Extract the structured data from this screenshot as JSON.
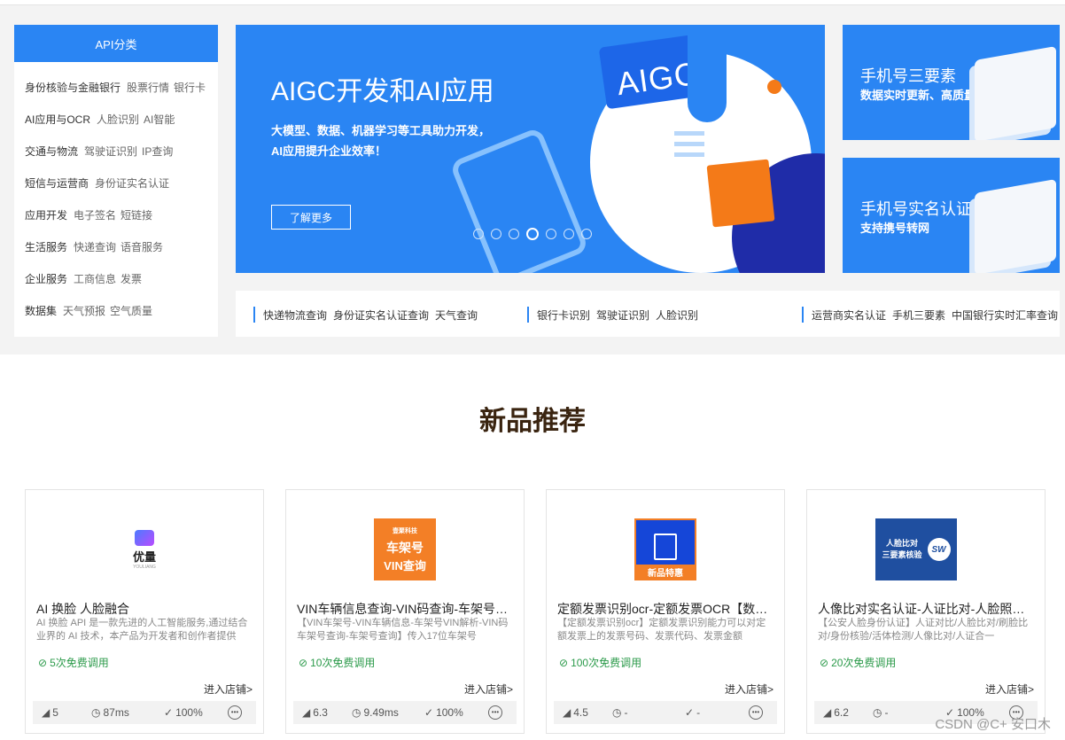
{
  "category_menu": {
    "header": "API分类",
    "rows": [
      {
        "main": "身份核验与金融银行",
        "subs": [
          "股票行情",
          "银行卡"
        ]
      },
      {
        "main": "AI应用与OCR",
        "subs": [
          "人脸识别",
          "AI智能"
        ]
      },
      {
        "main": "交通与物流",
        "subs": [
          "驾驶证识别",
          "IP查询"
        ]
      },
      {
        "main": "短信与运营商",
        "subs": [
          "身份证实名认证"
        ]
      },
      {
        "main": "应用开发",
        "subs": [
          "电子签名",
          "短链接"
        ]
      },
      {
        "main": "生活服务",
        "subs": [
          "快递查询",
          "语音服务"
        ]
      },
      {
        "main": "企业服务",
        "subs": [
          "工商信息",
          "发票"
        ]
      },
      {
        "main": "数据集",
        "subs": [
          "天气预报",
          "空气质量"
        ]
      }
    ]
  },
  "banner": {
    "title": "AIGC开发和AI应用",
    "description": "大模型、数据、机器学习等工具助力开发，AI应用提升企业效率！",
    "button_label": "了解更多",
    "art_text": "AIGC",
    "dot_count": 7,
    "active_dot": 3,
    "colors": {
      "background": "#2a85f3",
      "accent_orange": "#f47a18",
      "deep_blue": "#1f2ca8"
    }
  },
  "promos": [
    {
      "title": "手机号三要素",
      "subtitle": "数据实时更新、高质量接口"
    },
    {
      "title": "手机号实名认证",
      "subtitle": "支持携号转网"
    }
  ],
  "hot_links": [
    [
      "快递物流查询",
      "身份证实名认证查询",
      "天气查询"
    ],
    [
      "银行卡识别",
      "驾驶证识别",
      "人脸识别"
    ],
    [
      "运营商实名认证",
      "手机三要素",
      "中国银行实时汇率查询"
    ]
  ],
  "section": {
    "title": "新品推荐"
  },
  "products": [
    {
      "name": "AI 换脸 人脸融合",
      "description": "AI 换脸 API 是一款先进的人工智能服务,通过结合业界的 AI 技术，本产品为开发者和创作者提供",
      "free_calls": "5次免费调用",
      "shop_link": "进入店铺>",
      "score": "5",
      "latency": "87ms",
      "success_rate": "100%",
      "logo": {
        "icon": "youliang-logo",
        "text": "优量",
        "small": "YOULIANG"
      }
    },
    {
      "name": "VIN车辆信息查询-VIN码查询-车架号查询",
      "description": "【VIN车架号-VIN车辆信息-车架号VIN解析-VIN码车架号查询-车架号查询】传入17位车架号",
      "free_calls": "10次免费调用",
      "shop_link": "进入店铺>",
      "score": "6.3",
      "latency": "9.49ms",
      "success_rate": "100%",
      "logo": {
        "icon": "cloud-logo",
        "brand": "壹聚科技",
        "line1": "车架号",
        "line2": "VIN查询"
      }
    },
    {
      "name": "定额发票识别ocr-定额发票OCR【数据实时】",
      "description": "【定额发票识别ocr】定额发票识别能力可以对定额发票上的发票号码、发票代码、发票金额",
      "free_calls": "100次免费调用",
      "shop_link": "进入店铺>",
      "score": "4.5",
      "latency": "-",
      "success_rate": "-",
      "logo": {
        "icon": "invoice-logo",
        "badge": "新品特惠"
      }
    },
    {
      "name": "人像比对实名认证-人证比对-人脸照片比对",
      "description": "【公安人脸身份认证】人证对比/人脸比对/刷脸比对/身份核验/活体检测/人像比对/人证合一",
      "free_calls": "20次免费调用",
      "shop_link": "进入店铺>",
      "score": "6.2",
      "latency": "-",
      "success_rate": "100%",
      "logo": {
        "icon": "face-compare-logo",
        "line1": "人脸比对",
        "line2": "三要素核验",
        "mark": "SW"
      }
    }
  ],
  "watermark": "CSDN @C+ 安口木"
}
